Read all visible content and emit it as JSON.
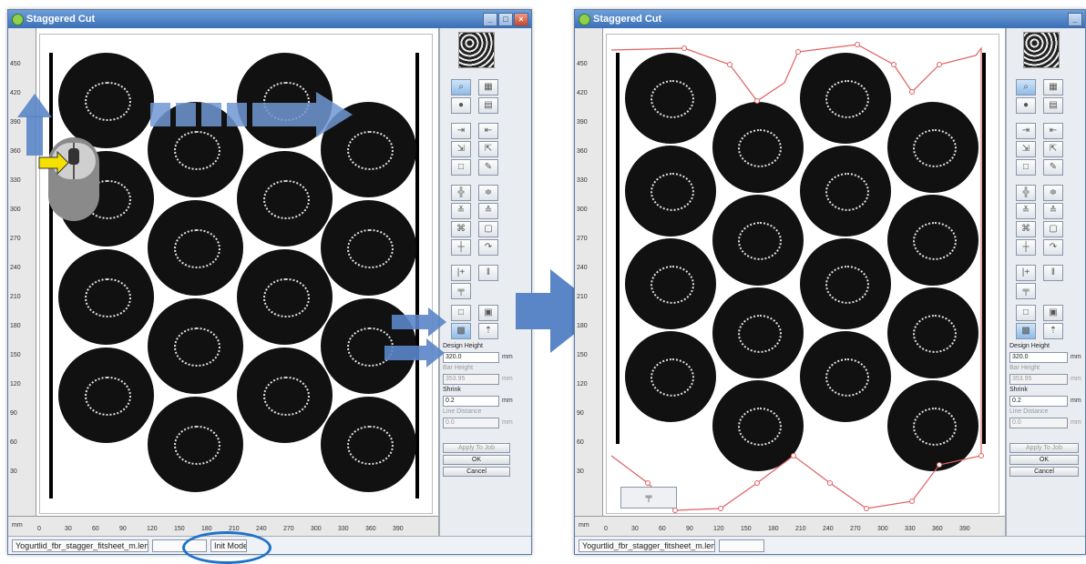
{
  "windows": [
    {
      "title": "Staggered Cut",
      "status": {
        "filename": "Yogurtlid_fbr_stagger_fitsheet_m.len",
        "mode": "Init Mode"
      },
      "form": {
        "design_height_label": "Design Height",
        "design_height_value": "320.0",
        "bar_height_label": "Bar Height",
        "bar_height_value": "353.95",
        "shrink_label": "Shrink",
        "shrink_value": "0.2",
        "line_distance_label": "Line Distance",
        "line_distance_value": "0.0",
        "unit": "mm",
        "apply_label": "Apply To Job",
        "ok_label": "OK",
        "cancel_label": "Cancel"
      }
    },
    {
      "title": "Staggered Cut",
      "status": {
        "filename": "Yogurtlid_fbr_stagger_fitsheet_m.len",
        "mode": ""
      },
      "form": {
        "design_height_label": "Design Height",
        "design_height_value": "320.0",
        "bar_height_label": "Bar Height",
        "bar_height_value": "353.95",
        "shrink_label": "Shrink",
        "shrink_value": "0.2",
        "line_distance_label": "Line Distance",
        "line_distance_value": "0.0",
        "unit": "mm",
        "apply_label": "Apply To Job",
        "ok_label": "OK",
        "cancel_label": "Cancel"
      }
    }
  ],
  "rulers": {
    "vertical": [
      "450",
      "420",
      "390",
      "360",
      "330",
      "300",
      "270",
      "240",
      "210",
      "180",
      "150",
      "120",
      "90",
      "60",
      "30"
    ],
    "horizontal": [
      "0",
      "30",
      "60",
      "90",
      "120",
      "150",
      "180",
      "210",
      "240",
      "270",
      "300",
      "330",
      "360",
      "390"
    ],
    "unit_label": "mm"
  },
  "icons": [
    "zoom-icon",
    "grid-icon",
    "camera-icon",
    "layout-icon",
    "stagger-left-icon",
    "stagger-right-icon",
    "cut-icon",
    "edit-icon",
    "align-center-icon",
    "distribute-icon",
    "mirror-icon",
    "rotate-icon",
    "stagger-tool-icon",
    "save-icon"
  ],
  "colors": {
    "titlebar": "#3b6fb6",
    "accent_arrow": "#5a86c8",
    "cut_line": "#e06060"
  }
}
